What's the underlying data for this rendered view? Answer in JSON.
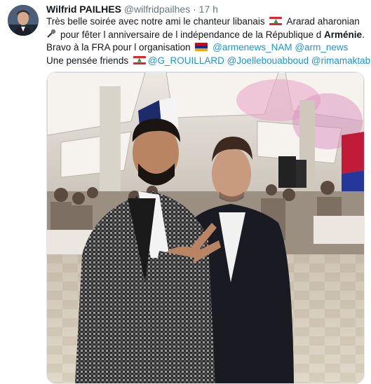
{
  "tweet": {
    "author_name": "Wilfrid PAILHES",
    "handle": "@wilfridpailhes",
    "separator": "·",
    "time": "17 h",
    "line1_a": "Très belle soirée avec notre ami le chanteur libanais",
    "line1_b": "Ararad aharonian",
    "line2_a": "pour fêter l anniversaire de l indépendance de la République d",
    "line2_b": "Arménie",
    "line2_c": ".",
    "line3_a": "Bravo à la FRA pour l organisation",
    "mention_1": "@armenews_NAM",
    "mention_2": "@arm_news",
    "line4_a": "Une pensée friends",
    "mention_3": "@G_ROUILLARD",
    "mention_4": "@Joellebouabboud",
    "mention_5": "@rimamaktabi"
  },
  "icons": [
    "lebanon-flag-icon",
    "microphone-icon",
    "armenia-flag-icon"
  ],
  "colors": {
    "link": "#1b95e0",
    "secondary_text": "#657786",
    "primary_text": "#14171a"
  }
}
